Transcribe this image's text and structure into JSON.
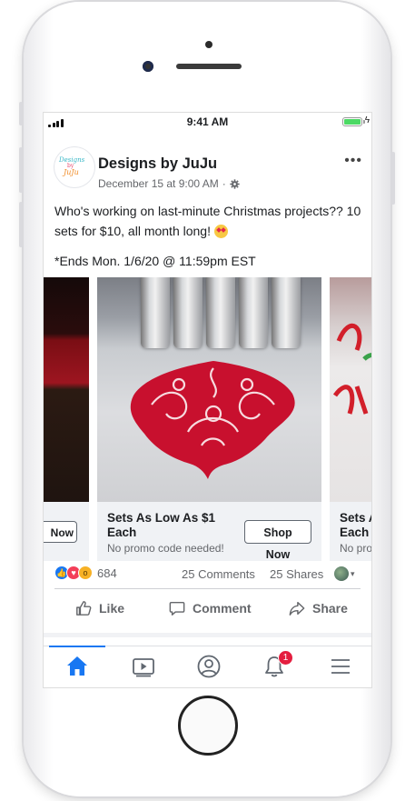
{
  "status_bar": {
    "time": "9:41 AM"
  },
  "post": {
    "page_name": "Designs by JuJu",
    "date": "December 15 at 9:00 AM",
    "separator": "·",
    "avatar_logo": {
      "line1": "Designs",
      "line2": "by",
      "line3": "JuJu"
    },
    "text_line": "Who's working on last-minute Christmas projects?? 10 sets for $10, all month long!",
    "text_end": "*Ends Mon. 1/6/20 @ 11:59pm EST",
    "more_glyph": "•••"
  },
  "carousel": {
    "left_card": {
      "button_partial": "Now"
    },
    "main_card": {
      "title": "Sets As Low As $1 Each",
      "subtitle": "No promo code needed!",
      "button": "Shop Now"
    },
    "right_card": {
      "title": "Sets As Each",
      "subtitle": "No pro"
    }
  },
  "engagement": {
    "reaction_count": "684",
    "comments": "25 Comments",
    "shares": "25 Shares",
    "caret": "▾"
  },
  "actions": {
    "like": "Like",
    "comment": "Comment",
    "share": "Share"
  },
  "tabbar": {
    "notification_badge": "1"
  },
  "colors": {
    "fb_blue": "#1877f2",
    "badge_red": "#e41e3f",
    "embroidery_red": "#c8102e"
  }
}
